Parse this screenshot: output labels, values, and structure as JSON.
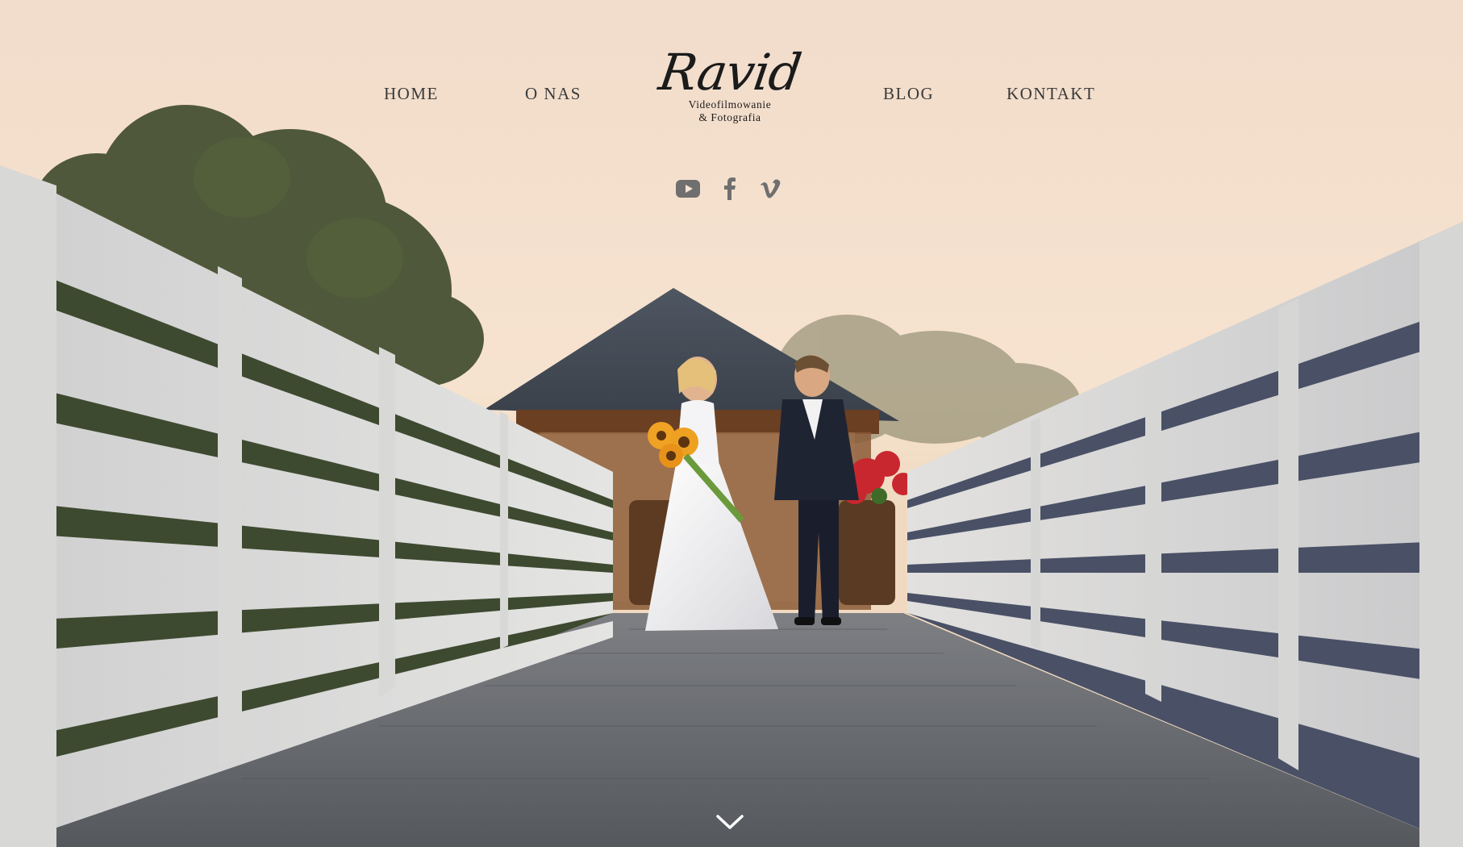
{
  "nav": {
    "home": "HOME",
    "about": "O NAS",
    "blog": "BLOG",
    "contact": "KONTAKT"
  },
  "logo": {
    "script": "Ravid",
    "line1": "Videofilmowanie",
    "line2": "& Fotografia"
  },
  "social": {
    "icons": [
      "youtube-icon",
      "facebook-icon",
      "vimeo-icon"
    ],
    "color": "#6f6f6f"
  },
  "scroll": {
    "icon": "chevron-down-icon",
    "color": "#ffffff"
  },
  "colors": {
    "nav_text": "#3a3a3a",
    "logo_text": "#1b1b1b"
  }
}
